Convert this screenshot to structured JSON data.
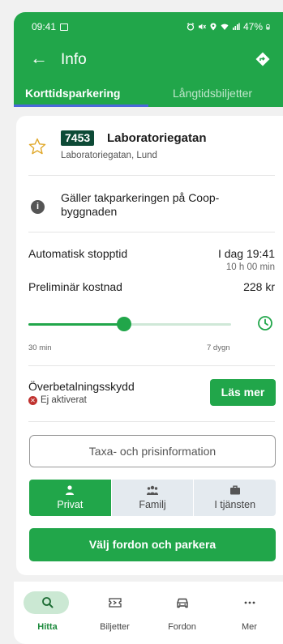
{
  "status_bar": {
    "time": "09:41",
    "battery": "47%"
  },
  "app_bar": {
    "title": "Info"
  },
  "tabs": [
    {
      "label": "Korttidsparkering",
      "active": true
    },
    {
      "label": "Långtidsbiljetter",
      "active": false
    }
  ],
  "zone": {
    "code": "7453",
    "name": "Laboratoriegatan",
    "address": "Laboratoriegatan, Lund"
  },
  "info_text": "Gäller takparkeringen på Coop-byggnaden",
  "stop_time": {
    "label": "Automatisk stopptid",
    "value": "I dag 19:41",
    "duration": "10 h 00 min"
  },
  "cost": {
    "label": "Preliminär kostnad",
    "value": "228 kr"
  },
  "slider": {
    "min_label": "30 min",
    "max_label": "7 dygn",
    "fraction": 0.47
  },
  "overpayment": {
    "title": "Överbetalningsskydd",
    "status": "Ej aktiverat",
    "button_label": "Läs mer"
  },
  "rates_button": "Taxa- och prisinformation",
  "segments": [
    {
      "label": "Privat",
      "icon": "person-icon",
      "active": true
    },
    {
      "label": "Familj",
      "icon": "family-icon",
      "active": false
    },
    {
      "label": "I tjänsten",
      "icon": "briefcase-icon",
      "active": false
    }
  ],
  "primary_button": "Välj fordon och parkera",
  "bottom_nav": [
    {
      "label": "Hitta",
      "icon": "search-icon",
      "active": true
    },
    {
      "label": "Biljetter",
      "icon": "ticket-icon",
      "active": false
    },
    {
      "label": "Fordon",
      "icon": "car-icon",
      "active": false
    },
    {
      "label": "Mer",
      "icon": "more-icon",
      "active": false
    }
  ],
  "colors": {
    "brand": "#21a64a",
    "badge": "#0d4a36",
    "tab_indicator": "#4a67d9",
    "error": "#c0322f"
  }
}
